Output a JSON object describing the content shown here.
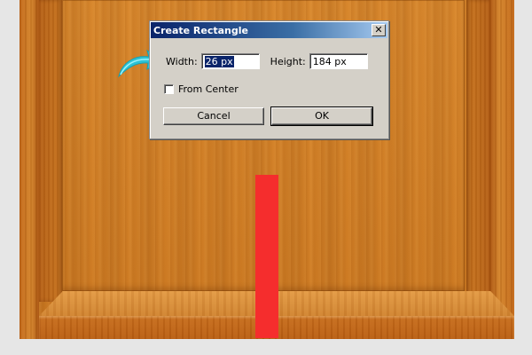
{
  "dialog": {
    "title": "Create Rectangle",
    "close_glyph": "✕",
    "width_label": "Width:",
    "width_value": "26 px",
    "height_label": "Height:",
    "height_value": "184 px",
    "from_center_label": "From Center",
    "from_center_checked": false,
    "cancel_label": "Cancel",
    "ok_label": "OK"
  },
  "colors": {
    "rectangle": "#f52d2d",
    "arrow": "#2ec4d6",
    "wood": "#d08330",
    "titlebar": "#0a246a"
  },
  "icons": {
    "pointer": "curved-arrow-icon",
    "close": "close-icon"
  }
}
